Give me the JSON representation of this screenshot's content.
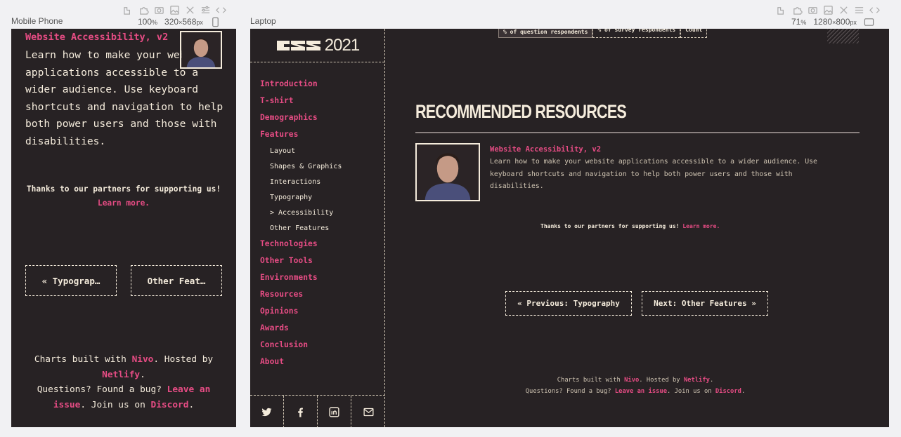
{
  "mobile": {
    "label": "Mobile Phone",
    "zoom": "100",
    "zoom_unit": "%",
    "width": "320",
    "height": "568",
    "dim_unit": "px",
    "resource_title": "Website Accessibility, v2",
    "resource_desc": "Learn how to make your website applications accessible to a wider audience. Use keyboard shortcuts and navigation to help both power users and those with disabilities.",
    "thanks": "Thanks to our partners for supporting us!",
    "learn_more": "Learn more.",
    "prev_label": "« Typograp…",
    "next_label": "Other Feat…",
    "footer": {
      "built": "Charts built with",
      "nivo": "Nivo",
      "hosted": ". Hosted by",
      "netlify": "Netlify",
      "dot": ".",
      "questions": "Questions? Found a bug?",
      "leave": "Leave an issue",
      "join": ". Join us on",
      "discord": "Discord",
      "end": "."
    }
  },
  "laptop": {
    "label": "Laptop",
    "zoom": "71",
    "zoom_unit": "%",
    "width": "1280",
    "height": "800",
    "dim_unit": "px",
    "logo_year": "2021",
    "nav": [
      {
        "label": "Introduction"
      },
      {
        "label": "T-shirt"
      },
      {
        "label": "Demographics"
      },
      {
        "label": "Features"
      }
    ],
    "subnav": [
      {
        "label": "Layout"
      },
      {
        "label": "Shapes & Graphics"
      },
      {
        "label": "Interactions"
      },
      {
        "label": "Typography"
      },
      {
        "label": "> Accessibility"
      },
      {
        "label": "Other Features"
      }
    ],
    "nav2": [
      {
        "label": "Technologies"
      },
      {
        "label": "Other Tools"
      },
      {
        "label": "Environments"
      },
      {
        "label": "Resources"
      },
      {
        "label": "Opinions"
      },
      {
        "label": "Awards"
      },
      {
        "label": "Conclusion"
      },
      {
        "label": "About"
      }
    ],
    "tabs": [
      "% of question respondents",
      "% of survey respondents",
      "Count"
    ],
    "section_title": "RECOMMENDED RESOURCES",
    "resource_title": "Website Accessibility, v2",
    "resource_desc": "Learn how to make your website applications accessible to a wider audience. Use keyboard shortcuts and navigation to help both power users and those with disabilities.",
    "thanks": "Thanks to our partners for supporting us!",
    "learn_more": "Learn more.",
    "prev_label": "« Previous: Typography",
    "next_label": "Next: Other Features »",
    "footer": {
      "built": "Charts built with",
      "nivo": "Nivo",
      "hosted": ". Hosted by",
      "netlify": "Netlify",
      "dot": ".",
      "questions": "Questions? Found a bug?",
      "leave": "Leave an issue",
      "join": ". Join us on",
      "discord": "Discord",
      "end": "."
    }
  },
  "colors": {
    "bg": "#272224",
    "accent": "#e64c84",
    "text": "#f5ecdc"
  },
  "icons": [
    "twitter-icon",
    "facebook-icon",
    "linkedin-icon",
    "email-icon"
  ]
}
